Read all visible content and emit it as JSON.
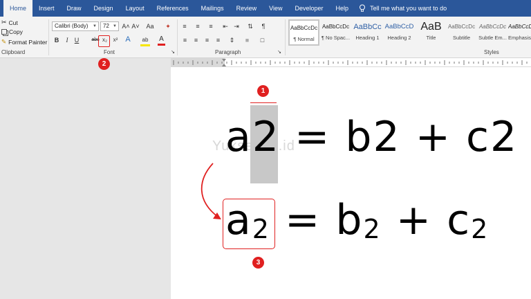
{
  "tabs": [
    "Home",
    "Insert",
    "Draw",
    "Design",
    "Layout",
    "References",
    "Mailings",
    "Review",
    "View",
    "Developer",
    "Help"
  ],
  "tell_me": "Tell me what you want to do",
  "clipboard": {
    "cut": "Cut",
    "copy": "Copy",
    "format_painter": "Format Painter",
    "group_label": "Clipboard"
  },
  "font": {
    "name": "Calibri (Body)",
    "size": "72",
    "group_label": "Font",
    "bold": "B",
    "italic": "I",
    "underline": "U",
    "strike": "abc",
    "subscript": "x₂",
    "superscript": "x²",
    "grow": "A˄",
    "shrink": "A˅",
    "change_case": "Aa",
    "effects": "A",
    "highlight": "ab",
    "color": "A"
  },
  "paragraph": {
    "group_label": "Paragraph"
  },
  "styles": {
    "group_label": "Styles",
    "items": [
      {
        "preview": "AaBbCcDc",
        "label": "¶ Normal"
      },
      {
        "preview": "AaBbCcDc",
        "label": "¶ No Spac..."
      },
      {
        "preview": "AaBbCc",
        "label": "Heading 1"
      },
      {
        "preview": "AaBbCcD",
        "label": "Heading 2"
      },
      {
        "preview": "AaB",
        "label": "Title"
      },
      {
        "preview": "AaBbCcDc",
        "label": "Subtitle"
      },
      {
        "preview": "AaBbCcDc",
        "label": "Subtle Em..."
      },
      {
        "preview": "AaBbCcDc",
        "label": "Emphasis"
      }
    ]
  },
  "document": {
    "watermark": "Yuksetest.id",
    "eq1": {
      "a": "a2",
      "rest": " = b2 + c2"
    },
    "eq2": {
      "a": "a",
      "a_sub": "2",
      "eq": " = b",
      "b_sub": "2",
      "plus": " + c",
      "c_sub": "2"
    }
  },
  "badges": [
    "1",
    "2",
    "3"
  ],
  "colors": {
    "ribbon_blue": "#2b579a",
    "annotation_red": "#e02020",
    "highlight_gray": "#c8c8c8"
  }
}
